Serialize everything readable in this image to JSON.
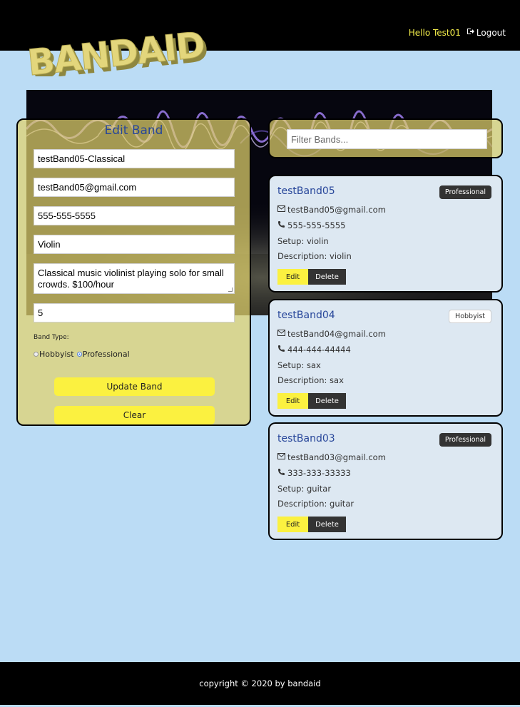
{
  "header": {
    "logo_text": "BANDAID",
    "greeting": "Hello Test01",
    "logout_label": "Logout"
  },
  "edit_form": {
    "title": "Edit Band",
    "name_value": "testBand05-Classical",
    "email_value": "testBand05@gmail.com",
    "phone_value": "555-555-5555",
    "setup_value": "Violin",
    "description_value": "Classical music violinist playing solo for small crowds. $100/hour",
    "number_value": "5",
    "band_type_label": "Band Type:",
    "options": [
      "Hobbyist",
      "Professional"
    ],
    "selected_option": "Professional",
    "update_label": "Update Band",
    "clear_label": "Clear"
  },
  "filter": {
    "placeholder": "Filter Bands..."
  },
  "bands": [
    {
      "name": "testBand05",
      "badge": "Professional",
      "email": "testBand05@gmail.com",
      "phone": "555-555-5555",
      "setup": "Setup: violin",
      "description": "Description: violin",
      "edit_label": "Edit",
      "delete_label": "Delete"
    },
    {
      "name": "testBand04",
      "badge": "Hobbyist",
      "email": "testBand04@gmail.com",
      "phone": "444-444-44444",
      "setup": "Setup: sax",
      "description": "Description: sax",
      "edit_label": "Edit",
      "delete_label": "Delete"
    },
    {
      "name": "testBand03",
      "badge": "Professional",
      "email": "testBand03@gmail.com",
      "phone": "333-333-33333",
      "setup": "Setup: guitar",
      "description": "Description: guitar",
      "edit_label": "Edit",
      "delete_label": "Delete"
    }
  ],
  "footer": {
    "copyright": "copyright © 2020 by bandaid"
  },
  "colors": {
    "accent_yellow": "#fbf140",
    "title_blue": "#27469a",
    "page_bg": "#bbdcf5"
  },
  "icons": [
    "logout-icon",
    "envelope-icon",
    "phone-icon"
  ]
}
